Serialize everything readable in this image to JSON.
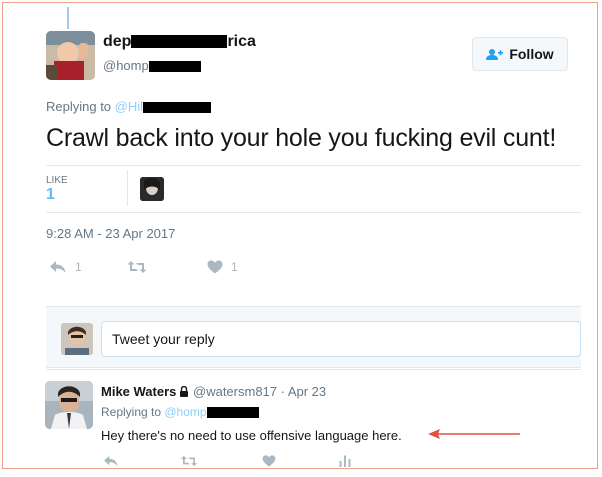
{
  "tweet": {
    "author": {
      "name_prefix": "dep",
      "name_suffix": "rica",
      "handle_prefix": "@homp"
    },
    "follow_label": "Follow",
    "replying_prefix": "Replying to ",
    "replying_handle": "@Hil",
    "text": "Crawl back into your hole you fucking evil cunt!",
    "likes_label": "LIKE",
    "likes_count": "1",
    "timestamp": "9:28 AM - 23 Apr 2017",
    "actions": {
      "reply_count": "1",
      "like_count": "1"
    }
  },
  "reply_box": {
    "placeholder": "Tweet your reply"
  },
  "reply_tweet": {
    "name": "Mike Waters",
    "meta": " @watersm817 · Apr 23",
    "replying_prefix": "Replying to ",
    "replying_handle": "@homp",
    "text": "Hey there's no need to use offensive language here."
  },
  "colors": {
    "accent": "#1da1f2",
    "annotation": "#e0513e",
    "frame": "#f0a08c"
  },
  "icons": [
    "add-user-icon",
    "reply-icon",
    "retweet-icon",
    "heart-icon",
    "lock-icon",
    "analytics-icon",
    "arrow-annotation-icon"
  ]
}
